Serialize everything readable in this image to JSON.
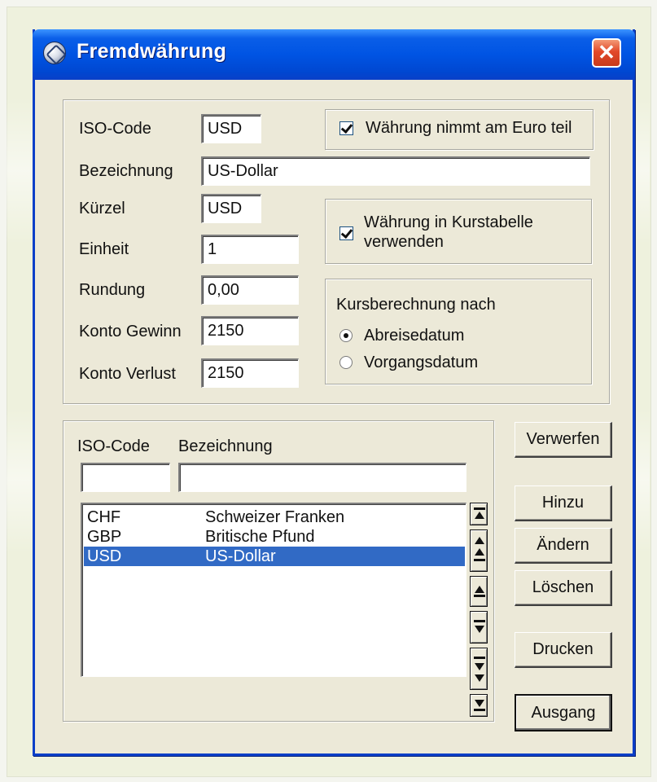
{
  "window": {
    "title": "Fremdwährung",
    "close_symbol": "✕"
  },
  "form": {
    "iso_code_label": "ISO-Code",
    "iso_code_value": "USD",
    "euro_checkbox_label": "Währung nimmt am Euro teil",
    "euro_checked": true,
    "bezeichnung_label": "Bezeichnung",
    "bezeichnung_value": "US-Dollar",
    "kuerzel_label": "Kürzel",
    "kuerzel_value": "USD",
    "einheit_label": "Einheit",
    "einheit_value": "1",
    "kurstabelle_label_line1": "Währung in Kurstabelle",
    "kurstabelle_label_line2": "verwenden",
    "kurstabelle_checked": true,
    "rundung_label": "Rundung",
    "rundung_value": "0,00",
    "konto_gewinn_label": "Konto Gewinn",
    "konto_gewinn_value": "2150",
    "konto_verlust_label": "Konto Verlust",
    "konto_verlust_value": "2150",
    "kursberechnung_title": "Kursberechnung nach",
    "radio_abreise_label": "Abreisedatum",
    "radio_vorgang_label": "Vorgangsdatum",
    "kursberechnung_selected": "Abreisedatum"
  },
  "search": {
    "iso_code_header": "ISO-Code",
    "bezeichnung_header": "Bezeichnung",
    "iso_code_filter": "",
    "bezeichnung_filter": ""
  },
  "list": {
    "rows": [
      {
        "code": "CHF",
        "name": "Schweizer Franken",
        "selected": false
      },
      {
        "code": "GBP",
        "name": "Britische Pfund",
        "selected": false
      },
      {
        "code": "USD",
        "name": "US-Dollar",
        "selected": true
      }
    ]
  },
  "buttons": {
    "verwerfen": "Verwerfen",
    "hinzu": "Hinzu",
    "aendern": "Ändern",
    "loeschen": "Löschen",
    "drucken": "Drucken",
    "ausgang": "Ausgang"
  },
  "colors": {
    "selection": "#316ac5",
    "title_bar": "#0054e3",
    "dialog_bg": "#ece9d8"
  }
}
